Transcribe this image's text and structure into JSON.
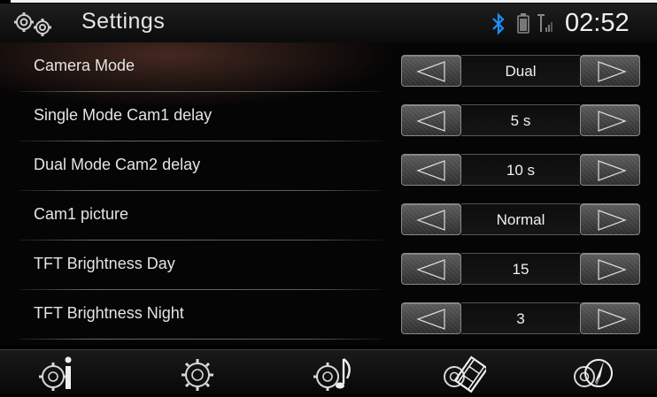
{
  "header": {
    "title": "Settings",
    "clock": "02:52",
    "icons": [
      "settings-gears-icon",
      "bluetooth-icon",
      "battery-icon",
      "signal-icon"
    ]
  },
  "settings": [
    {
      "label": "Camera Mode",
      "value": "Dual"
    },
    {
      "label": "Single Mode Cam1 delay",
      "value": "5 s"
    },
    {
      "label": "Dual Mode Cam2 delay",
      "value": "10 s"
    },
    {
      "label": "Cam1 picture",
      "value": "Normal"
    },
    {
      "label": "TFT Brightness Day",
      "value": "15"
    },
    {
      "label": "TFT Brightness Night",
      "value": "3"
    }
  ],
  "footer": {
    "nav_icons": [
      "info-settings-icon",
      "general-settings-icon",
      "audio-settings-icon",
      "video-settings-icon",
      "navigation-settings-icon"
    ]
  },
  "colors": {
    "background": "#000000",
    "text": "#e8e8e8",
    "accent_bluetooth": "#1e8fff"
  }
}
